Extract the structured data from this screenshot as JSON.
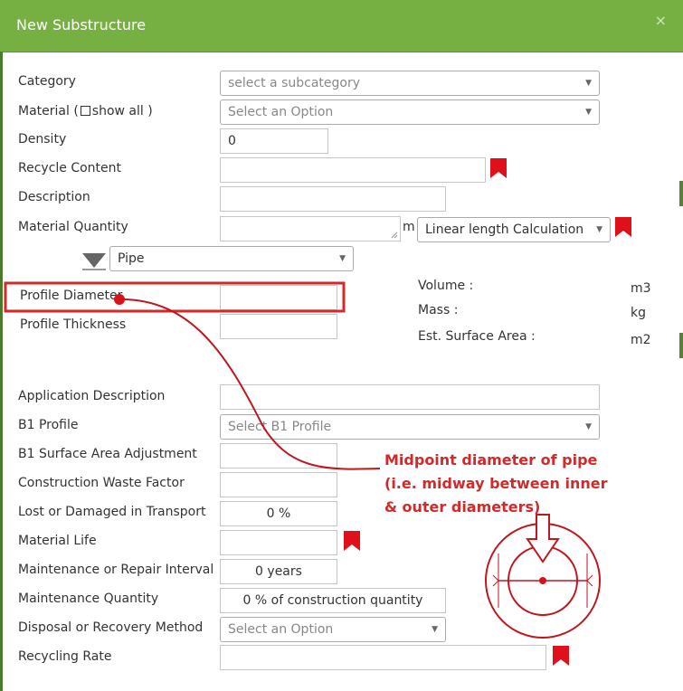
{
  "dialog": {
    "title": "New Substructure",
    "close_glyph": "×"
  },
  "fields": {
    "category": {
      "label": "Category",
      "placeholder": "select a subcategory"
    },
    "material": {
      "label_prefix": "Material (",
      "show_all": "show all )",
      "placeholder": "Select an Option"
    },
    "density": {
      "label": "Density",
      "value": "0"
    },
    "recycle_content": {
      "label": "Recycle Content",
      "value": ""
    },
    "description": {
      "label": "Description",
      "value": ""
    },
    "material_quantity": {
      "label": "Material Quantity",
      "unit": "m",
      "calc_selected": "Linear length Calculation"
    },
    "shape": {
      "selected": "Pipe"
    },
    "profile_diameter": {
      "label": "Profile Diameter",
      "value": ""
    },
    "profile_thickness": {
      "label": "Profile Thickness",
      "value": ""
    },
    "application_description": {
      "label": "Application Description",
      "value": ""
    },
    "b1_profile": {
      "label": "B1 Profile",
      "placeholder": "Select B1 Profile"
    },
    "b1_surface_area_adjustment": {
      "label": "B1 Surface Area Adjustment",
      "value": ""
    },
    "construction_waste_factor": {
      "label": "Construction Waste Factor",
      "value": ""
    },
    "lost_or_damaged": {
      "label": "Lost or Damaged in Transport",
      "value": "0 %"
    },
    "material_life": {
      "label": "Material Life",
      "value": ""
    },
    "maintenance_interval": {
      "label": "Maintenance or Repair Interval",
      "value": "0 years"
    },
    "maintenance_quantity": {
      "label": "Maintenance Quantity",
      "value": "0 % of construction quantity"
    },
    "disposal_method": {
      "label": "Disposal or Recovery Method",
      "placeholder": "Select an Option"
    },
    "recycling_rate": {
      "label": "Recycling Rate",
      "value": ""
    }
  },
  "results": {
    "volume": {
      "label": "Volume :",
      "unit": "m3"
    },
    "mass": {
      "label": "Mass :",
      "unit": "kg"
    },
    "surface_area": {
      "label": "Est. Surface Area :",
      "unit": "m2"
    }
  },
  "annotation": {
    "line1": "Midpoint diameter of pipe",
    "line2": "(i.e. midway between inner",
    "line3": "& outer diameters)"
  },
  "colors": {
    "header_green": "#76b043",
    "annotation_red": "#d22a2a",
    "bookmark_red": "#e0101a"
  },
  "icons": {
    "bookmark": "bookmark-icon",
    "close": "close-icon",
    "caret": "caret-down-icon",
    "funnel": "funnel-icon"
  }
}
